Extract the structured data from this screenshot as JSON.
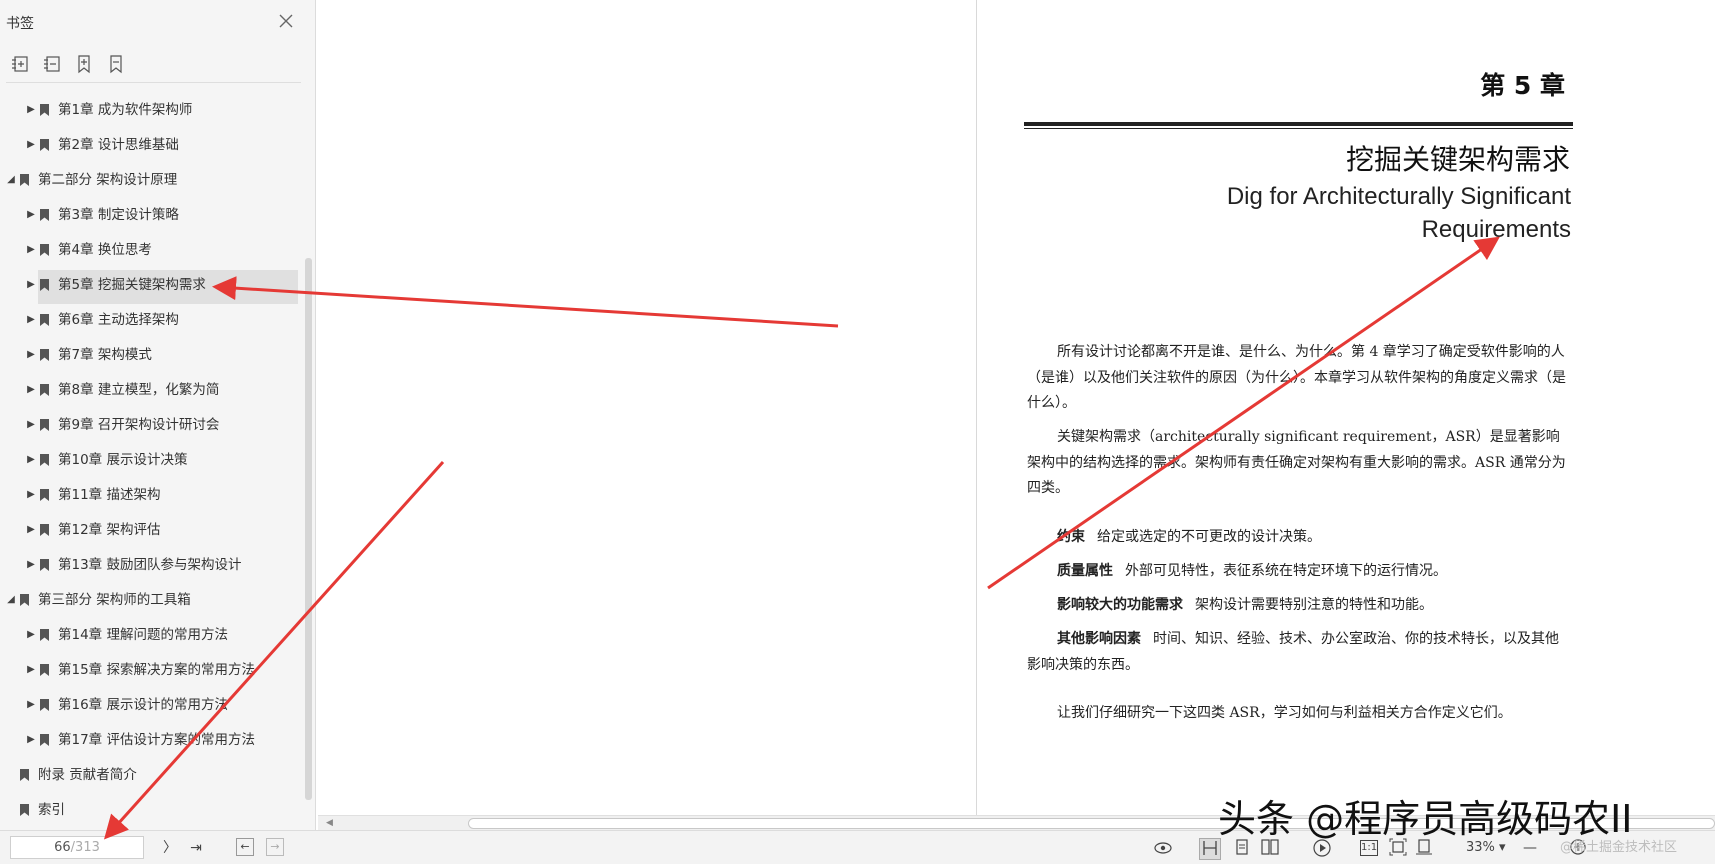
{
  "sidebar": {
    "title": "书签",
    "toolbar": [
      "expand-all-icon",
      "collapse-all-icon",
      "add-bookmark-icon",
      "delete-bookmark-icon"
    ],
    "items": [
      {
        "label": "第1章  成为软件架构师",
        "level": 1,
        "expanded": false
      },
      {
        "label": "第2章  设计思维基础",
        "level": 1,
        "expanded": false
      },
      {
        "label": "第二部分  架构设计原理",
        "level": 0,
        "expanded": true
      },
      {
        "label": "第3章  制定设计策略",
        "level": 1,
        "expanded": false
      },
      {
        "label": "第4章  换位思考",
        "level": 1,
        "expanded": false
      },
      {
        "label": "第5章  挖掘关键架构需求",
        "level": 1,
        "expanded": false,
        "selected": true
      },
      {
        "label": "第6章  主动选择架构",
        "level": 1,
        "expanded": false
      },
      {
        "label": "第7章  架构模式",
        "level": 1,
        "expanded": false
      },
      {
        "label": "第8章  建立模型，化繁为简",
        "level": 1,
        "expanded": false
      },
      {
        "label": "第9章  召开架构设计研讨会",
        "level": 1,
        "expanded": false
      },
      {
        "label": "第10章  展示设计决策",
        "level": 1,
        "expanded": false
      },
      {
        "label": "第11章  描述架构",
        "level": 1,
        "expanded": false
      },
      {
        "label": "第12章  架构评估",
        "level": 1,
        "expanded": false
      },
      {
        "label": "第13章  鼓励团队参与架构设计",
        "level": 1,
        "expanded": false
      },
      {
        "label": "第三部分  架构师的工具箱",
        "level": 0,
        "expanded": true
      },
      {
        "label": "第14章  理解问题的常用方法",
        "level": 1,
        "expanded": false
      },
      {
        "label": "第15章  探索解决方案的常用方法",
        "level": 1,
        "expanded": false
      },
      {
        "label": "第16章  展示设计的常用方法",
        "level": 1,
        "expanded": false
      },
      {
        "label": "第17章  评估设计方案的常用方法",
        "level": 1,
        "expanded": false
      },
      {
        "label": "附录  贡献者简介",
        "level": 0,
        "leaf": true
      },
      {
        "label": "索引",
        "level": 0,
        "leaf": true
      }
    ]
  },
  "page": {
    "chapter_number": "第 5 章",
    "chapter_title": "挖掘关键架构需求",
    "chapter_title_en_line1": "Dig for Architecturally Significant",
    "chapter_title_en_line2": "Requirements",
    "para1": "所有设计讨论都离不开是谁、是什么、为什么。第 4 章学习了确定受软件影响的人（是谁）以及他们关注软件的原因（为什么）。本章学习从软件架构的角度定义需求（是什么）。",
    "para2": "关键架构需求（architecturally significant requirement，ASR）是显著影响架构中的结构选择的需求。架构师有责任确定对架构有重大影响的需求。ASR 通常分为四类。",
    "terms": [
      {
        "term": "约束",
        "desc": "给定或选定的不可更改的设计决策。"
      },
      {
        "term": "质量属性",
        "desc": "外部可见特性，表征系统在特定环境下的运行情况。"
      },
      {
        "term": "影响较大的功能需求",
        "desc": "架构设计需要特别注意的特性和功能。"
      },
      {
        "term": "其他影响因素",
        "desc": "时间、知识、经验、技术、办公室政治、你的技术特长，以及其他影响决策的东西。"
      }
    ],
    "para3": "让我们仔细研究一下这四类 ASR，学习如何与利益相关方合作定义它们。"
  },
  "statusbar": {
    "page_current": "66",
    "page_total": "/313",
    "zoom": "33%",
    "icons": [
      "next-page-icon",
      "last-page-icon",
      "back-icon",
      "forward-icon",
      "eye-icon",
      "single-page-icon",
      "continuous-page-icon",
      "two-page-icon",
      "play-icon",
      "actual-size-icon",
      "fit-page-icon",
      "fit-width-icon",
      "zoom-out-icon",
      "zoom-in-icon"
    ]
  },
  "watermark": {
    "main": "头条 @程序员高级码农II",
    "small": "@稀土掘金技术社区"
  },
  "annotation_color": "#e53935"
}
